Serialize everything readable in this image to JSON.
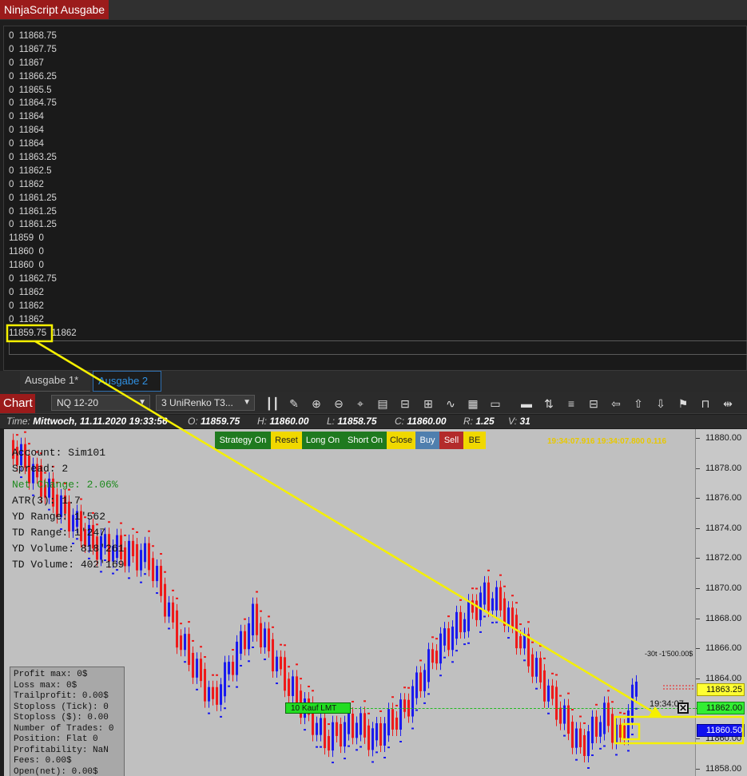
{
  "output_window": {
    "title": "NinjaScript Ausgabe",
    "lines": [
      "0  11868.75",
      "0  11867.75",
      "0  11867",
      "0  11866.25",
      "0  11865.5",
      "0  11864.75",
      "0  11864",
      "0  11864",
      "0  11864",
      "0  11863.25",
      "0  11862.5",
      "0  11862",
      "0  11861.25",
      "0  11861.25",
      "0  11861.25",
      "11859  0",
      "11860  0",
      "11860  0",
      "0  11862.75",
      "0  11862",
      "0  11862",
      "0  11862",
      "11859.75  11862"
    ],
    "tabs": [
      "Ausgabe 1*",
      "Ausgabe 2"
    ]
  },
  "chart": {
    "tab_label": "Chart",
    "instrument": "NQ 12-20",
    "bar_type": "3 UniRenko T3...",
    "data_line": {
      "time_label": "Time:",
      "time": "Mittwoch, 11.11.2020 19:33:56",
      "o_label": "O:",
      "o": "11859.75",
      "h_label": "H:",
      "h": "11860.00",
      "l_label": "L:",
      "l": "11858.75",
      "c_label": "C:",
      "c": "11860.00",
      "r_label": "R:",
      "r": "1.25",
      "v_label": "V:",
      "v": "31"
    },
    "buttons": {
      "strategy": "Strategy On",
      "reset": "Reset",
      "long": "Long On",
      "short": "Short On",
      "close": "Close",
      "buy": "Buy",
      "sell": "Sell",
      "be": "BE"
    },
    "timer": "19:34:07.916   19:34:07.800   0.116",
    "info": {
      "account": "Account: Sim101",
      "spread": "Spread: 2",
      "net_change": "Net Change: 2.06%",
      "atr": "ATR(3): 1.7",
      "yd_range": "YD Range: 1'562",
      "td_range": "TD Range: 1'247",
      "yd_volume": "YD Volume: 818'261",
      "td_volume": "TD Volume: 402'169"
    },
    "stats": [
      "Profit max: 0$",
      "Loss max: 0$",
      "Trailprofit: 0.00$",
      "Stoploss (Tick): 0",
      "Stoploss ($): 0.00",
      "Number of Trades: 0",
      "Position: Flat 0",
      "Profitability: NaN",
      "Fees: 0.00$",
      "Open(net): 0.00$"
    ],
    "order_label": "10  Kauf LMT",
    "clock": "19:34:07",
    "risk_text": "-30t -1'500.00$",
    "price_flags": [
      "11863.25",
      "11862.00",
      "11860.50"
    ],
    "yaxis_ticks": [
      "11880.00",
      "11878.00",
      "11876.00",
      "11874.00",
      "11872.00",
      "11870.00",
      "11868.00",
      "11866.00",
      "11864.00",
      "11862.00",
      "11860.00",
      "11858.00"
    ],
    "colors": {
      "up": "#1a1aee",
      "down": "#ee1a1a",
      "order": "#22dd22",
      "annotation": "#f5f000"
    }
  }
}
